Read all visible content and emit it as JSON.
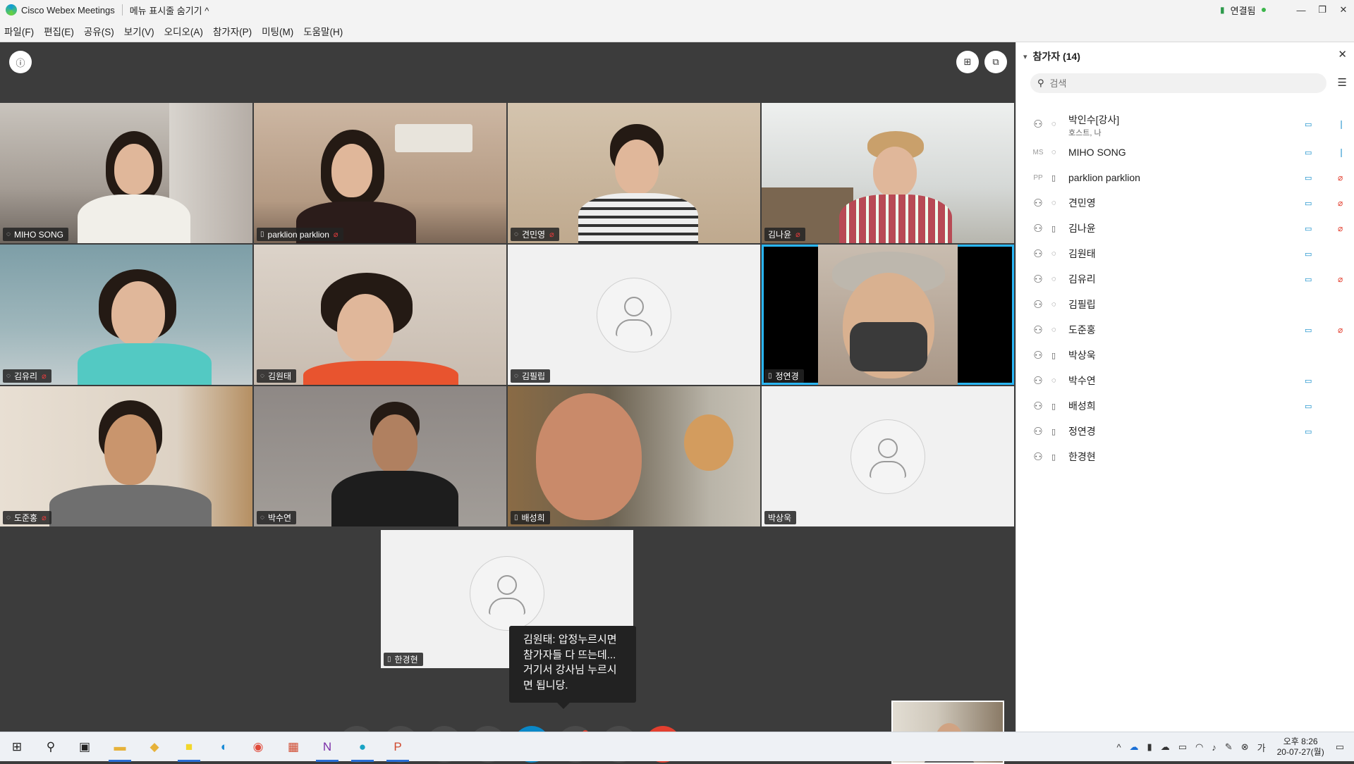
{
  "titlebar": {
    "app_title": "Cisco Webex Meetings",
    "hide_menu": "메뉴 표시줄 숨기기 ^",
    "connection": "연결됨"
  },
  "menus": [
    "파일(F)",
    "편집(E)",
    "공유(S)",
    "보기(V)",
    "오디오(A)",
    "참가자(P)",
    "미팅(M)",
    "도움말(H)"
  ],
  "tiles": [
    {
      "name": "MIHO SONG",
      "audio": "headset",
      "muted": false,
      "active": true
    },
    {
      "name": "parklion parklion",
      "audio": "phone",
      "muted": true,
      "active": false
    },
    {
      "name": "견민영",
      "audio": "headset",
      "muted": true,
      "active": false
    },
    {
      "name": "김나윤",
      "audio": "none",
      "muted": true,
      "active": false
    },
    {
      "name": "김유리",
      "audio": "headset",
      "muted": true,
      "active": false
    },
    {
      "name": "김원태",
      "audio": "headset",
      "muted": false,
      "active": false
    },
    {
      "name": "김필립",
      "audio": "headset",
      "muted": false,
      "active": false
    },
    {
      "name": "정연경",
      "audio": "phone",
      "muted": false,
      "active": true
    },
    {
      "name": "도준홍",
      "audio": "headset",
      "muted": true,
      "active": false
    },
    {
      "name": "박수연",
      "audio": "headset",
      "muted": false,
      "active": false
    },
    {
      "name": "배성희",
      "audio": "phone",
      "muted": false,
      "active": false
    },
    {
      "name": "박상욱",
      "audio": "none",
      "muted": false,
      "active": false
    },
    {
      "name": "한경현",
      "audio": "phone",
      "muted": false,
      "active": false
    }
  ],
  "chat_tooltip": "김원태: 압정누르시면 참가자들 다 뜨는데... 거기서 강사님 누르시면 됩니당.",
  "panel": {
    "title": "참가자 (14)",
    "search_placeholder": "검색",
    "participants": [
      {
        "name": "박인수[강사]",
        "sub": "호스트, 나",
        "initials": "",
        "audio": "headset",
        "video": true,
        "mic": "on"
      },
      {
        "name": "MIHO SONG",
        "sub": "",
        "initials": "MS",
        "audio": "headset",
        "video": true,
        "mic": "on"
      },
      {
        "name": "parklion parklion",
        "sub": "",
        "initials": "PP",
        "audio": "phone",
        "video": true,
        "mic": "muted"
      },
      {
        "name": "견민영",
        "sub": "",
        "initials": "",
        "audio": "headset",
        "video": true,
        "mic": "muted"
      },
      {
        "name": "김나윤",
        "sub": "",
        "initials": "",
        "audio": "phone",
        "video": true,
        "mic": "muted"
      },
      {
        "name": "김원태",
        "sub": "",
        "initials": "",
        "audio": "headset",
        "video": true,
        "mic": "none"
      },
      {
        "name": "김유리",
        "sub": "",
        "initials": "",
        "audio": "headset",
        "video": true,
        "mic": "muted"
      },
      {
        "name": "김필립",
        "sub": "",
        "initials": "",
        "audio": "headset",
        "video": false,
        "mic": "none"
      },
      {
        "name": "도준홍",
        "sub": "",
        "initials": "",
        "audio": "headset",
        "video": true,
        "mic": "muted"
      },
      {
        "name": "박상욱",
        "sub": "",
        "initials": "",
        "audio": "phone",
        "video": false,
        "mic": "none"
      },
      {
        "name": "박수연",
        "sub": "",
        "initials": "",
        "audio": "headset",
        "video": true,
        "mic": "none"
      },
      {
        "name": "배성희",
        "sub": "",
        "initials": "",
        "audio": "phone",
        "video": true,
        "mic": "none"
      },
      {
        "name": "정연경",
        "sub": "",
        "initials": "",
        "audio": "phone",
        "video": true,
        "mic": "none"
      },
      {
        "name": "한경현",
        "sub": "",
        "initials": "",
        "audio": "phone",
        "video": false,
        "mic": "none"
      }
    ]
  },
  "clock": {
    "time": "오후 8:26",
    "date": "20-07-27(월)"
  },
  "colors": {
    "accent": "#0a88c8",
    "active_border": "#29b6f6",
    "end_call": "#e33f2f",
    "muted": "#e33f2f"
  }
}
